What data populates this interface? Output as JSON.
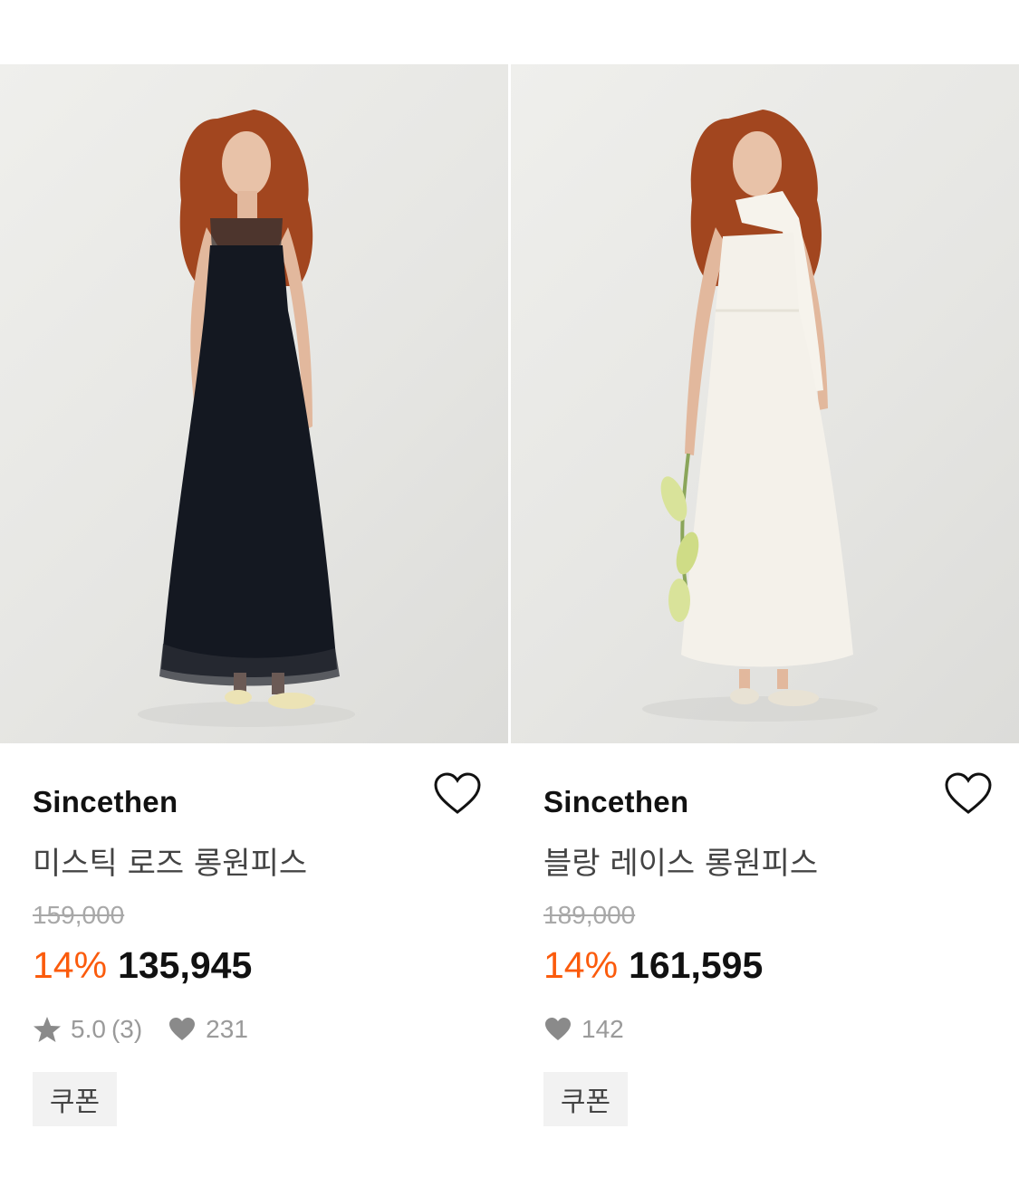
{
  "products": [
    {
      "brand": "Sincethen",
      "name": "미스틱 로즈 롱원피스",
      "original_price": "159,000",
      "discount": "14%",
      "sale_price": "135,945",
      "rating": "5.0",
      "review_count": "(3)",
      "likes": "231",
      "coupon_label": "쿠폰",
      "dress_color": "#141821"
    },
    {
      "brand": "Sincethen",
      "name": "블랑 레이스 롱원피스",
      "original_price": "189,000",
      "discount": "14%",
      "sale_price": "161,595",
      "likes": "142",
      "coupon_label": "쿠폰",
      "dress_color": "#f4f1ea"
    }
  ],
  "colors": {
    "discount": "#fb5b0c",
    "muted": "#9a9a9a",
    "coupon_bg": "#f2f2f2"
  },
  "icons": {
    "wishlist": "heart-outline-icon",
    "rating": "star-icon",
    "likes": "heart-filled-icon"
  }
}
